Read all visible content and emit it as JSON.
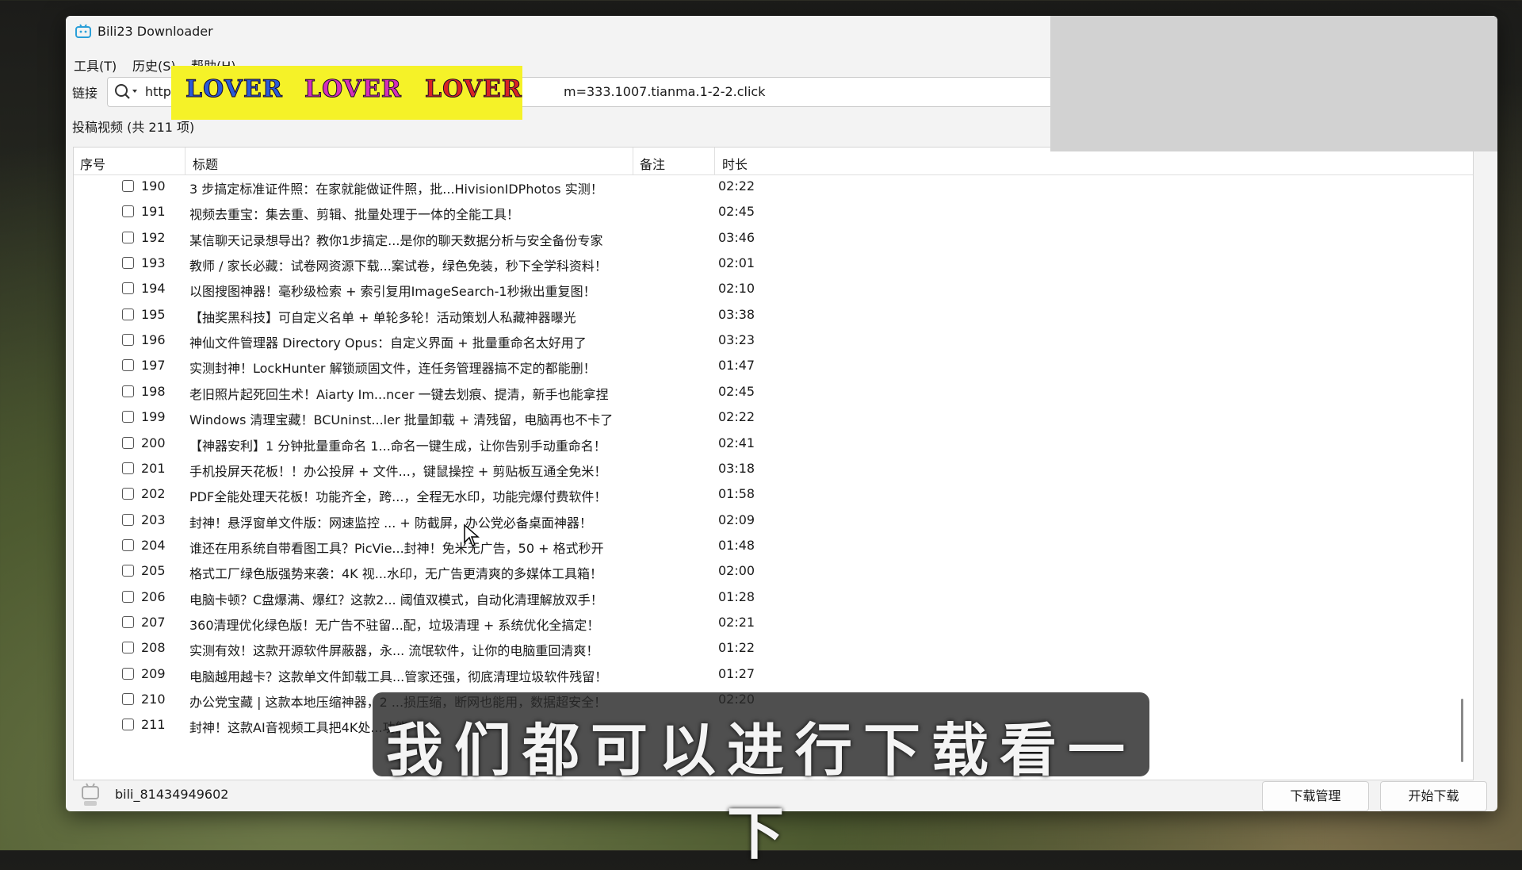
{
  "window": {
    "title": "Bili23 Downloader"
  },
  "menu": [
    "工具(T)",
    "历史(S)",
    "帮助(H)"
  ],
  "url_bar": {
    "label": "链接",
    "value_start": "http",
    "value_end": "m=333.1007.tianma.1-2-2.click"
  },
  "sticker": {
    "words": [
      "LOVER",
      "LOVER",
      "LOVER"
    ],
    "colors": [
      "#2a5bd7",
      "#d52fb8",
      "#d82424"
    ]
  },
  "list_header": "投稿视频 (共 211 项)",
  "columns": [
    "序号",
    "标题",
    "备注",
    "时长"
  ],
  "rows": [
    {
      "n": "190",
      "title": "3 步搞定标准证件照：在家就能做证件照，批...HivisionIDPhotos 实测！",
      "dur": "02:22"
    },
    {
      "n": "191",
      "title": "视频去重宝：集去重、剪辑、批量处理于一体的全能工具！",
      "dur": "02:45"
    },
    {
      "n": "192",
      "title": "某信聊天记录想导出？教你1步搞定...是你的聊天数据分析与安全备份专家",
      "dur": "03:46"
    },
    {
      "n": "193",
      "title": "教师 / 家长必藏：试卷网资源下载...案试卷，绿色免装，秒下全学科资料！",
      "dur": "02:01"
    },
    {
      "n": "194",
      "title": "以图搜图神器！毫秒级检索 + 索引复用ImageSearch-1秒揪出重复图！",
      "dur": "02:10"
    },
    {
      "n": "195",
      "title": "【抽奖黑科技】可自定义名单 + 单轮多轮！活动策划人私藏神器曝光",
      "dur": "03:38"
    },
    {
      "n": "196",
      "title": "神仙文件管理器 Directory Opus：自定义界面 + 批量重命名太好用了",
      "dur": "03:23"
    },
    {
      "n": "197",
      "title": "实测封神！LockHunter 解锁顽固文件，连任务管理器搞不定的都能删！",
      "dur": "01:47"
    },
    {
      "n": "198",
      "title": "老旧照片起死回生术！Aiarty Im...ncer 一键去划痕、提清，新手也能拿捏",
      "dur": "02:45"
    },
    {
      "n": "199",
      "title": "Windows 清理宝藏！BCUninst...ler 批量卸载 + 清残留，电脑再也不卡了",
      "dur": "02:22"
    },
    {
      "n": "200",
      "title": "【神器安利】1 分钟批量重命名 1...命名一键生成，让你告别手动重命名！",
      "dur": "02:41"
    },
    {
      "n": "201",
      "title": "手机投屏天花板！！办公投屏 + 文件...，键鼠操控 + 剪贴板互通全免米！",
      "dur": "03:18"
    },
    {
      "n": "202",
      "title": "PDF全能处理天花板！功能齐全，跨...，全程无水印，功能完爆付费软件！",
      "dur": "01:58"
    },
    {
      "n": "203",
      "title": "封神！悬浮窗单文件版：网速监控 ... + 防截屏，办公党必备桌面神器！",
      "dur": "02:09"
    },
    {
      "n": "204",
      "title": "谁还在用系统自带看图工具？PicVie...封神！免米无广告，50 + 格式秒开",
      "dur": "01:48"
    },
    {
      "n": "205",
      "title": "格式工厂绿色版强势来袭：4K 视...水印，无广告更清爽的多媒体工具箱！",
      "dur": "02:00"
    },
    {
      "n": "206",
      "title": "电脑卡顿？C盘爆满、爆红？这款2... 阈值双模式，自动化清理解放双手！",
      "dur": "01:28"
    },
    {
      "n": "207",
      "title": "360清理优化绿色版！无广告不驻留...配，垃圾清理 + 系统优化全搞定！",
      "dur": "02:21"
    },
    {
      "n": "208",
      "title": "实测有效！这款开源软件屏蔽器，永... 流氓软件，让你的电脑重回清爽！",
      "dur": "01:22"
    },
    {
      "n": "209",
      "title": "电脑越用越卡？这款单文件卸载工具...管家还强，彻底清理垃圾软件残留！",
      "dur": "01:27"
    },
    {
      "n": "210",
      "title": "办公党宝藏 | 这款本地压缩神器，2 ...损压缩，断网也能用，数据超安全！",
      "dur": "02:20"
    },
    {
      "n": "211",
      "title": "封神！这款AI音视频工具把4K处...功能",
      "dur": ""
    }
  ],
  "status": {
    "user": "bili_81434949602",
    "download_manager": "下载管理",
    "start_download": "开始下载"
  },
  "subtitle": "我们都可以进行下载看一下"
}
